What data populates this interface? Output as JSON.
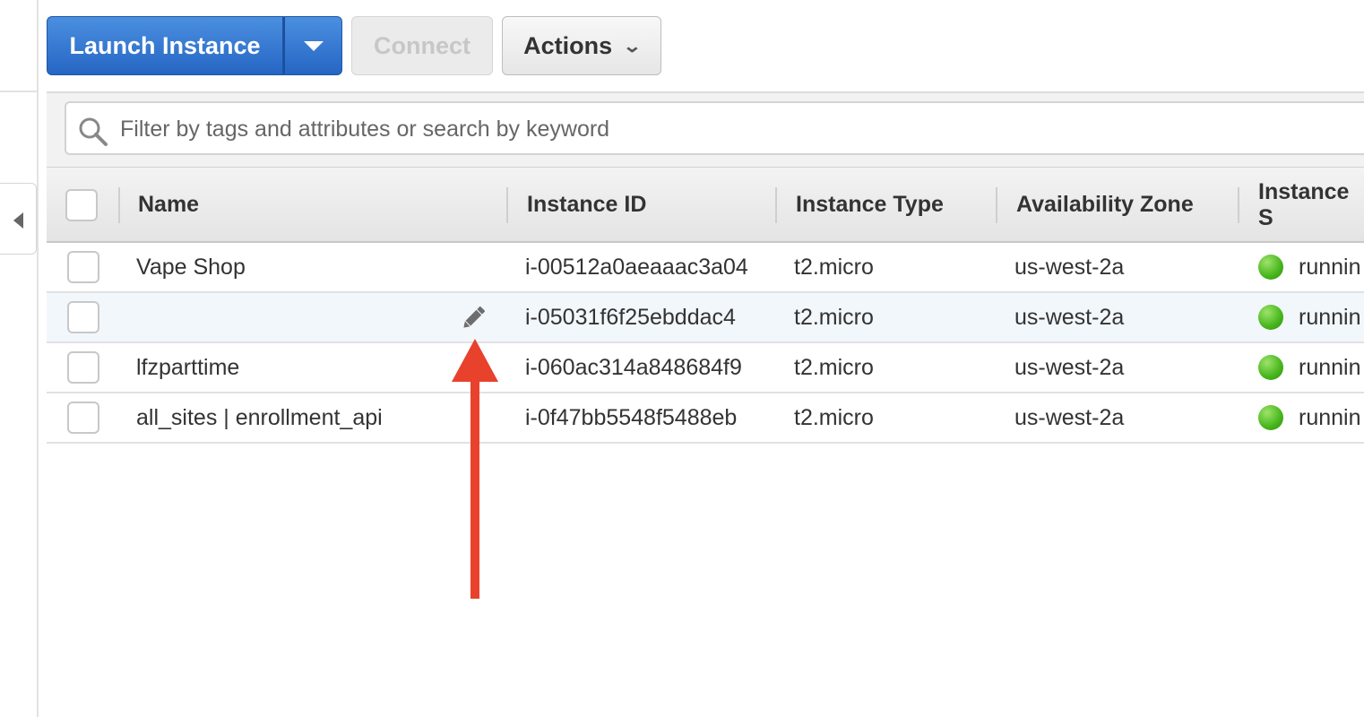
{
  "toolbar": {
    "launch_label": "Launch Instance",
    "connect_label": "Connect",
    "actions_label": "Actions"
  },
  "filter": {
    "placeholder": "Filter by tags and attributes or search by keyword"
  },
  "table": {
    "columns": [
      "Name",
      "Instance ID",
      "Instance Type",
      "Availability Zone",
      "Instance S"
    ],
    "rows": [
      {
        "name": "Vape Shop",
        "id": "i-00512a0aeaaac3a04",
        "type": "t2.micro",
        "zone": "us-west-2a",
        "state": "runnin"
      },
      {
        "name": "",
        "id": "i-05031f6f25ebddac4",
        "type": "t2.micro",
        "zone": "us-west-2a",
        "state": "runnin"
      },
      {
        "name": "lfzparttime",
        "id": "i-060ac314a848684f9",
        "type": "t2.micro",
        "zone": "us-west-2a",
        "state": "runnin"
      },
      {
        "name": "all_sites | enrollment_api",
        "id": "i-0f47bb5548f5488eb",
        "type": "t2.micro",
        "zone": "us-west-2a",
        "state": "runnin"
      }
    ]
  },
  "colors": {
    "primary": "#2566c4",
    "running": "#46b51b",
    "annotation_arrow": "#e8412c"
  }
}
